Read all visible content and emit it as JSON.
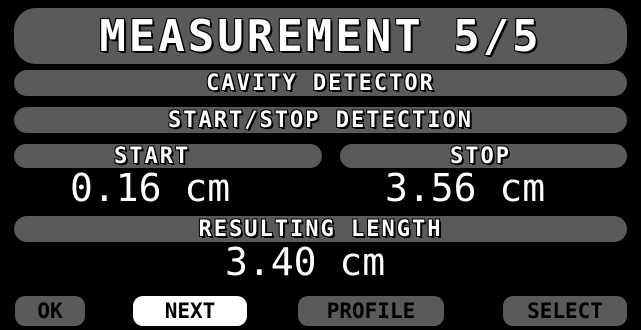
{
  "title": "MEASUREMENT 5/5",
  "subtitle1": "CAVITY DETECTOR",
  "subtitle2": "START/STOP DETECTION",
  "start": {
    "label": "START",
    "value": "0.16 cm"
  },
  "stop": {
    "label": "STOP",
    "value": "3.56 cm"
  },
  "result": {
    "label": "RESULTING LENGTH",
    "value": "3.40 cm"
  },
  "buttons": {
    "ok": "OK",
    "next": "NEXT",
    "profile": "PROFILE",
    "select": "SELECT"
  },
  "colors": {
    "bar": "#5a5a5a",
    "background": "#000000",
    "active_button": "#ffffff"
  }
}
